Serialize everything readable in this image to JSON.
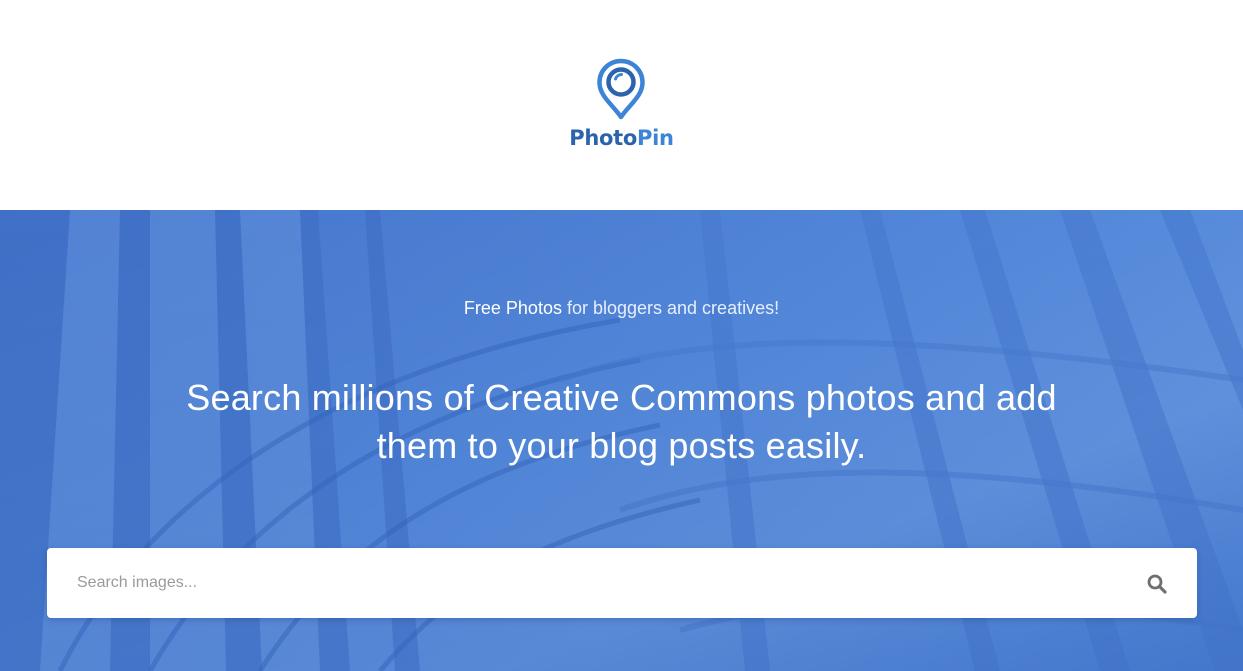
{
  "brand": {
    "name_part1": "Photo",
    "name_part2": "Pin",
    "icon": "map-pin-camera-lens-icon",
    "colors": {
      "dark_blue": "#2c63ad",
      "light_blue": "#3b84d6"
    }
  },
  "hero": {
    "tagline_strong": "Free Photos",
    "tagline_rest": " for bloggers and creatives!",
    "headline": "Search millions of Creative Commons photos and add them to your blog posts easily.",
    "overlay_color": "#4f86d9",
    "background_image": "library bookshelves photo with blue overlay"
  },
  "search": {
    "value": "",
    "placeholder": "Search images...",
    "button_icon": "search-icon"
  }
}
